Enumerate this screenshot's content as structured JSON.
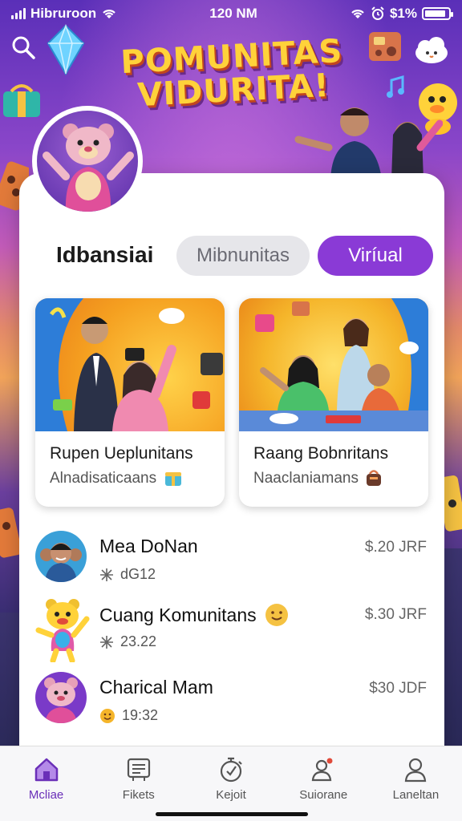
{
  "status_bar": {
    "carrier": "Hibruroon",
    "time": "120 NM",
    "battery_text": "$1%",
    "battery_level": 0.9
  },
  "header": {
    "title_line1": "POMUNITAS",
    "title_line2": "VIDURITA!"
  },
  "section": {
    "title": "Idbansiai",
    "chips": [
      {
        "label": "Mibnunitas",
        "active": false
      },
      {
        "label": "Viríual",
        "active": true
      }
    ]
  },
  "tiles": [
    {
      "title": "Rupen Ueplunitans",
      "subtitle": "Alnadisaticaans",
      "badge_icon": "gift-icon"
    },
    {
      "title": "Raang Bobnritans",
      "subtitle": "Naaclaniamans",
      "badge_icon": "bag-icon"
    }
  ],
  "rows": [
    {
      "name": "Mea DoNan",
      "meta": "dG12",
      "meta_icon": "sparkle-icon",
      "price": "$.20 JRF"
    },
    {
      "name": "Cuang Komunitans",
      "meta": "23.22",
      "meta_icon": "sparkle-icon",
      "price": "$.30 JRF"
    },
    {
      "name": "Charical Mam",
      "meta": "19:32",
      "meta_icon": "emoji-icon",
      "price": "$30 JDF"
    }
  ],
  "nav": [
    {
      "label": "Mcliae",
      "icon": "home-icon",
      "active": true
    },
    {
      "label": "Fikets",
      "icon": "ticket-icon",
      "active": false
    },
    {
      "label": "Kejoit",
      "icon": "timer-icon",
      "active": false
    },
    {
      "label": "Suiorane",
      "icon": "people-icon",
      "active": false
    },
    {
      "label": "Laneltan",
      "icon": "user-icon",
      "active": false
    }
  ],
  "colors": {
    "accent": "#8a3ad6",
    "title_yellow": "#ffd23a",
    "nav_active": "#6a2fb8"
  }
}
